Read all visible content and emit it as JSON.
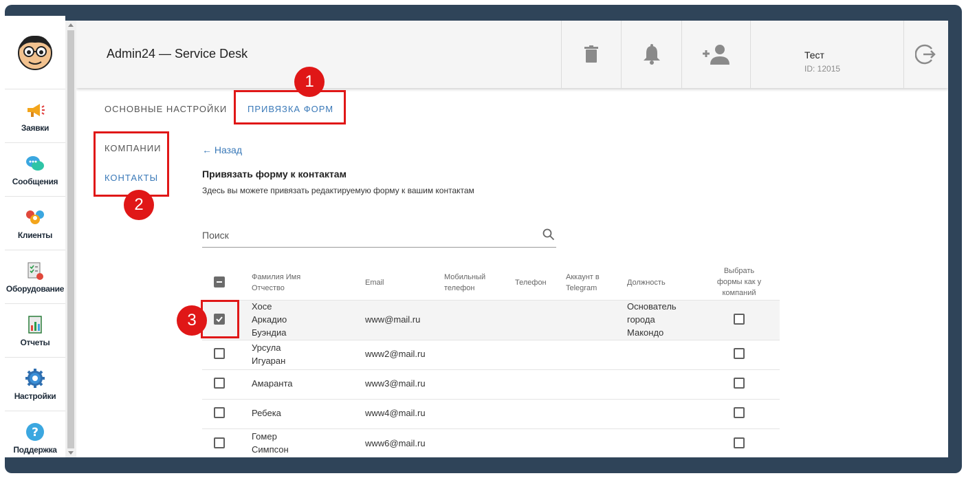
{
  "colors": {
    "accent": "#3a79b8",
    "annotation": "#e01717",
    "frame": "#2f4459"
  },
  "sidebar": {
    "items": [
      {
        "label": "Заявки",
        "icon": "megaphone-icon"
      },
      {
        "label": "Сообщения",
        "icon": "chat-bubbles-icon"
      },
      {
        "label": "Клиенты",
        "icon": "users-icon"
      },
      {
        "label": "Оборудование",
        "icon": "checklist-icon"
      },
      {
        "label": "Отчеты",
        "icon": "report-chart-icon"
      },
      {
        "label": "Настройки",
        "icon": "gear-icon"
      },
      {
        "label": "Поддержка",
        "icon": "help-icon"
      }
    ]
  },
  "header": {
    "title": "Admin24 — Service Desk",
    "icons": [
      "trash-icon",
      "bell-icon",
      "add-user-icon",
      "logout-icon"
    ],
    "user_name": "Тест",
    "user_id": "ID: 12015"
  },
  "tabs": [
    "ОСНОВНЫЕ НАСТРОЙКИ",
    "ПРИВЯЗКА ФОРМ"
  ],
  "subnav": [
    "КОМПАНИИ",
    "КОНТАКТЫ"
  ],
  "back_label": "Назад",
  "page_title": "Привязать форму к контактам",
  "page_subtitle": "Здесь вы можете привязать редактируемую форму к вашим контактам",
  "search": {
    "placeholder": "Поиск",
    "value": ""
  },
  "table": {
    "columns": [
      "Фамилия Имя Отчество",
      "Email",
      "Мобильный телефон",
      "Телефон",
      "Аккаунт в Telegram",
      "Должность",
      "Выбрать формы как у компаний"
    ],
    "header_checkbox": "indeterminate",
    "rows": [
      {
        "name": "Хосе Аркадио Буэндиа",
        "email": "www@mail.ru",
        "mobile": "",
        "phone": "",
        "telegram": "",
        "position": "Основатель города Макондо",
        "selected": true,
        "company_forms": false
      },
      {
        "name": "Урсула Игуаран",
        "email": "www2@mail.ru",
        "mobile": "",
        "phone": "",
        "telegram": "",
        "position": "",
        "selected": false,
        "company_forms": false
      },
      {
        "name": "Амаранта",
        "email": "www3@mail.ru",
        "mobile": "",
        "phone": "",
        "telegram": "",
        "position": "",
        "selected": false,
        "company_forms": false
      },
      {
        "name": "Ребека",
        "email": "www4@mail.ru",
        "mobile": "",
        "phone": "",
        "telegram": "",
        "position": "",
        "selected": false,
        "company_forms": false
      },
      {
        "name": "Гомер Симпсон",
        "email": "www6@mail.ru",
        "mobile": "",
        "phone": "",
        "telegram": "",
        "position": "",
        "selected": false,
        "company_forms": false
      }
    ]
  },
  "annotations": [
    "1",
    "2",
    "3"
  ]
}
